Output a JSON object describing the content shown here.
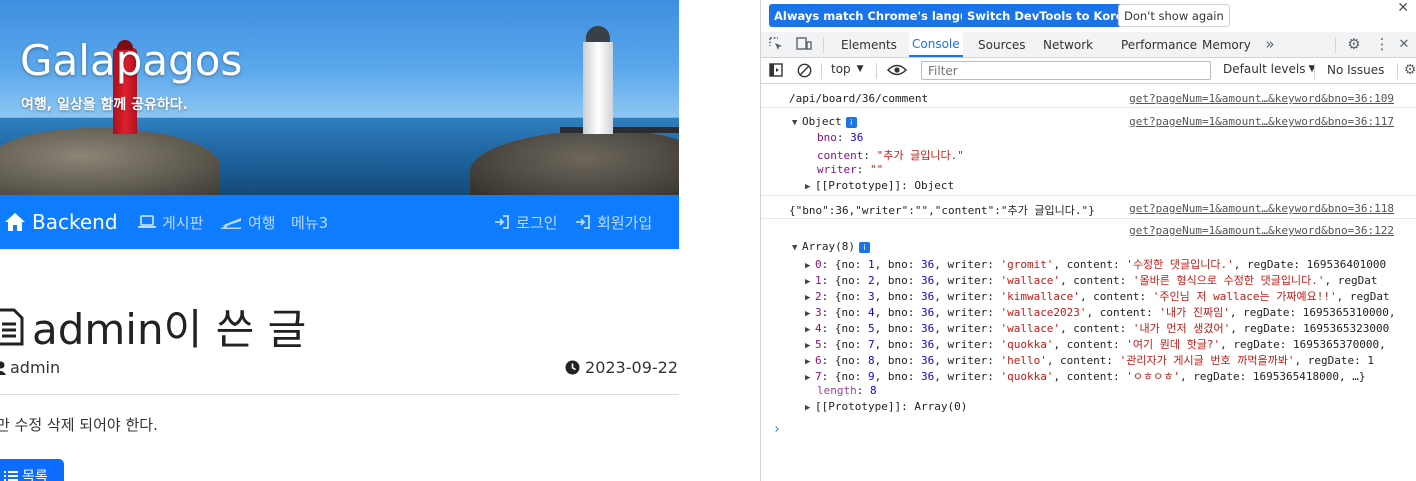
{
  "site": {
    "title": "Galapagos",
    "subtitle": "여행, 일상을 함께 공유하다.",
    "nav": {
      "brand": "Backend",
      "board": "게시판",
      "travel": "여행",
      "menu3": "메뉴3",
      "login": "로그인",
      "signup": "회원가입"
    },
    "post": {
      "title": "admin이 쓴 글",
      "author": "admin",
      "date": "2023-09-22",
      "body": "만 수정 삭제 되어야 한다.",
      "list_button": "목록"
    },
    "colors": {
      "navbar": "#0d7cff",
      "button": "#0d6efd"
    }
  },
  "devtools": {
    "lang_bar": {
      "match_lang": "Always match Chrome's language",
      "switch_korean": "Switch DevTools to Korean",
      "dont_show": "Don't show again"
    },
    "tabs": [
      "Elements",
      "Console",
      "Sources",
      "Network",
      "Performance",
      "Memory"
    ],
    "active_tab": "Console",
    "toolbar": {
      "context": "top",
      "filter_placeholder": "Filter",
      "levels": "Default levels",
      "issues": "No Issues"
    },
    "console": {
      "line1": {
        "msg": "/api/board/36/comment",
        "src": "get?pageNum=1&amount…&keyword&bno=36:109"
      },
      "object_header": {
        "label": "Object",
        "src": "get?pageNum=1&amount…&keyword&bno=36:117"
      },
      "object_props": [
        {
          "key": "bno",
          "val": "36",
          "type": "num"
        },
        {
          "key": "content",
          "val": "\"추가 글입니다.\"",
          "type": "str"
        },
        {
          "key": "writer",
          "val": "\"\"",
          "type": "str"
        }
      ],
      "object_proto": "[[Prototype]]: Object",
      "json_line": {
        "msg": "{\"bno\":36,\"writer\":\"\",\"content\":\"추가 글입니다.\"}",
        "src": "get?pageNum=1&amount…&keyword&bno=36:118"
      },
      "array_src": "get?pageNum=1&amount…&keyword&bno=36:122",
      "array_header": "Array(8)",
      "array_items": [
        {
          "idx": "0",
          "no": "1",
          "writer": "'gromit'",
          "content": "'수정한 댓글입니다.'",
          "tail": ", regDate: 169536401000"
        },
        {
          "idx": "1",
          "no": "2",
          "writer": "'wallace'",
          "content": "'올바른 형식으로 수정한 댓글입니다.'",
          "tail": ", regDat"
        },
        {
          "idx": "2",
          "no": "3",
          "writer": "'kimwallace'",
          "content": "'주인님 저 wallace는 가짜예요!!'",
          "tail": ", regDat"
        },
        {
          "idx": "3",
          "no": "4",
          "writer": "'wallace2023'",
          "content": "'내가 진짜임'",
          "tail": ", regDate: 1695365310000,"
        },
        {
          "idx": "4",
          "no": "5",
          "writer": "'wallace'",
          "content": "'내가 먼저 생겼어'",
          "tail": ", regDate: 1695365323000"
        },
        {
          "idx": "5",
          "no": "7",
          "writer": "'quokka'",
          "content": "'여기 뭔데 핫글?'",
          "tail": ", regDate: 1695365370000,"
        },
        {
          "idx": "6",
          "no": "8",
          "writer": "'hello'",
          "content": "'관리자가 게시글 번호 까먹을까봐'",
          "tail": ", regDate: 1"
        },
        {
          "idx": "7",
          "no": "9",
          "writer": "'quokka'",
          "content": "'ㅇㅎㅇㅎ'",
          "tail": ", regDate: 1695365418000, …}"
        }
      ],
      "length_key": "length",
      "length_val": "8",
      "array_proto": "[[Prototype]]: Array(0)"
    }
  }
}
